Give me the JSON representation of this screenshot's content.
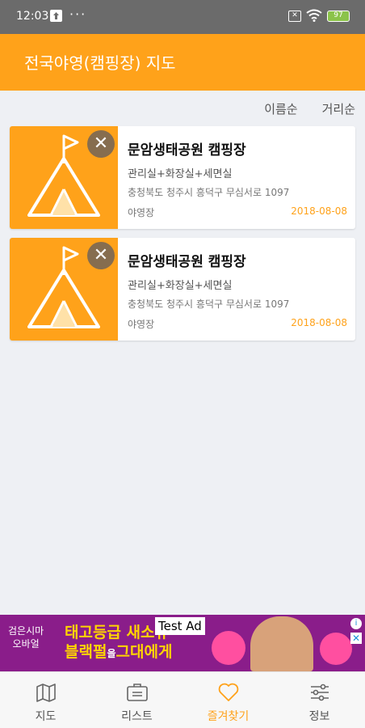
{
  "status_bar": {
    "time": "12:03",
    "dots": "···",
    "battery": "97"
  },
  "header": {
    "title": "전국야영(캠핑장) 지도"
  },
  "sort": {
    "by_name": "이름순",
    "by_distance": "거리순"
  },
  "favorites": [
    {
      "name": "문암생태공원 캠핑장",
      "facilities": "관리실+화장실+세면실",
      "address": "충청북도 청주시 흥덕구 무심서로 1097",
      "kind": "야영장",
      "date": "2018-08-08"
    },
    {
      "name": "문암생태공원 캠핑장",
      "facilities": "관리실+화장실+세면실",
      "address": "충청북도 청주시 흥덕구 무심서로 1097",
      "kind": "야영장",
      "date": "2018-08-08"
    }
  ],
  "ad": {
    "left_line1": "검은시마",
    "left_line2": "오바얼",
    "line1": "태고등급 새소유",
    "line2": "블랙펄",
    "line2_small": "을",
    "line2_end": "그대에게",
    "test_label": "Test Ad"
  },
  "nav": {
    "map": "지도",
    "list": "리스트",
    "favorites": "즐겨찾기",
    "info": "정보"
  },
  "colors": {
    "accent": "#ffa21a",
    "status_bar": "#6b6b6b",
    "background": "#eef0f4"
  }
}
